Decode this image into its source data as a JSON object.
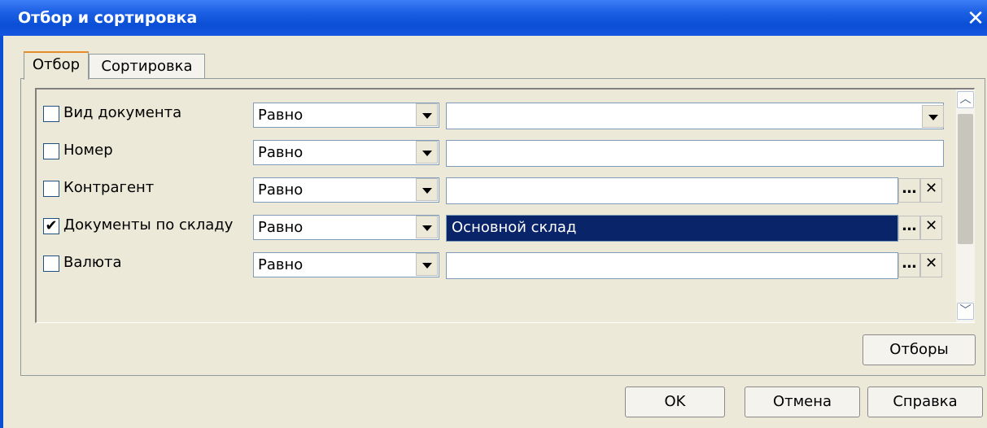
{
  "window": {
    "title": "Отбор и сортировка"
  },
  "tabs": [
    {
      "label": "Отбор",
      "active": true
    },
    {
      "label": "Сортировка",
      "active": false
    }
  ],
  "filters": [
    {
      "label": "Вид документа",
      "checked": false,
      "condition": "Равно",
      "value": "",
      "value_buttons": [
        "dropdown"
      ]
    },
    {
      "label": "Номер",
      "checked": false,
      "condition": "Равно",
      "value": "",
      "value_buttons": []
    },
    {
      "label": "Контрагент",
      "checked": false,
      "condition": "Равно",
      "value": "",
      "value_buttons": [
        "select",
        "clear"
      ]
    },
    {
      "label": "Документы по складу",
      "checked": true,
      "condition": "Равно",
      "value": "Основной склад",
      "value_buttons": [
        "select",
        "clear"
      ]
    },
    {
      "label": "Валюта",
      "checked": false,
      "condition": "Равно",
      "value": "",
      "value_buttons": [
        "select",
        "clear"
      ]
    }
  ],
  "buttons": {
    "filters": "Отборы",
    "ok": "OK",
    "cancel": "Отмена",
    "help": "Справка"
  },
  "icons": {
    "close": "close-icon",
    "select": "ellipsis-icon",
    "clear": "clear-x-icon",
    "dropdown": "chevron-down-icon",
    "checkmark": "checkmark-icon"
  },
  "colors": {
    "titlebar": "#0b4fd6",
    "selection": "#0a246a",
    "window_bg": "#ece9d8"
  }
}
